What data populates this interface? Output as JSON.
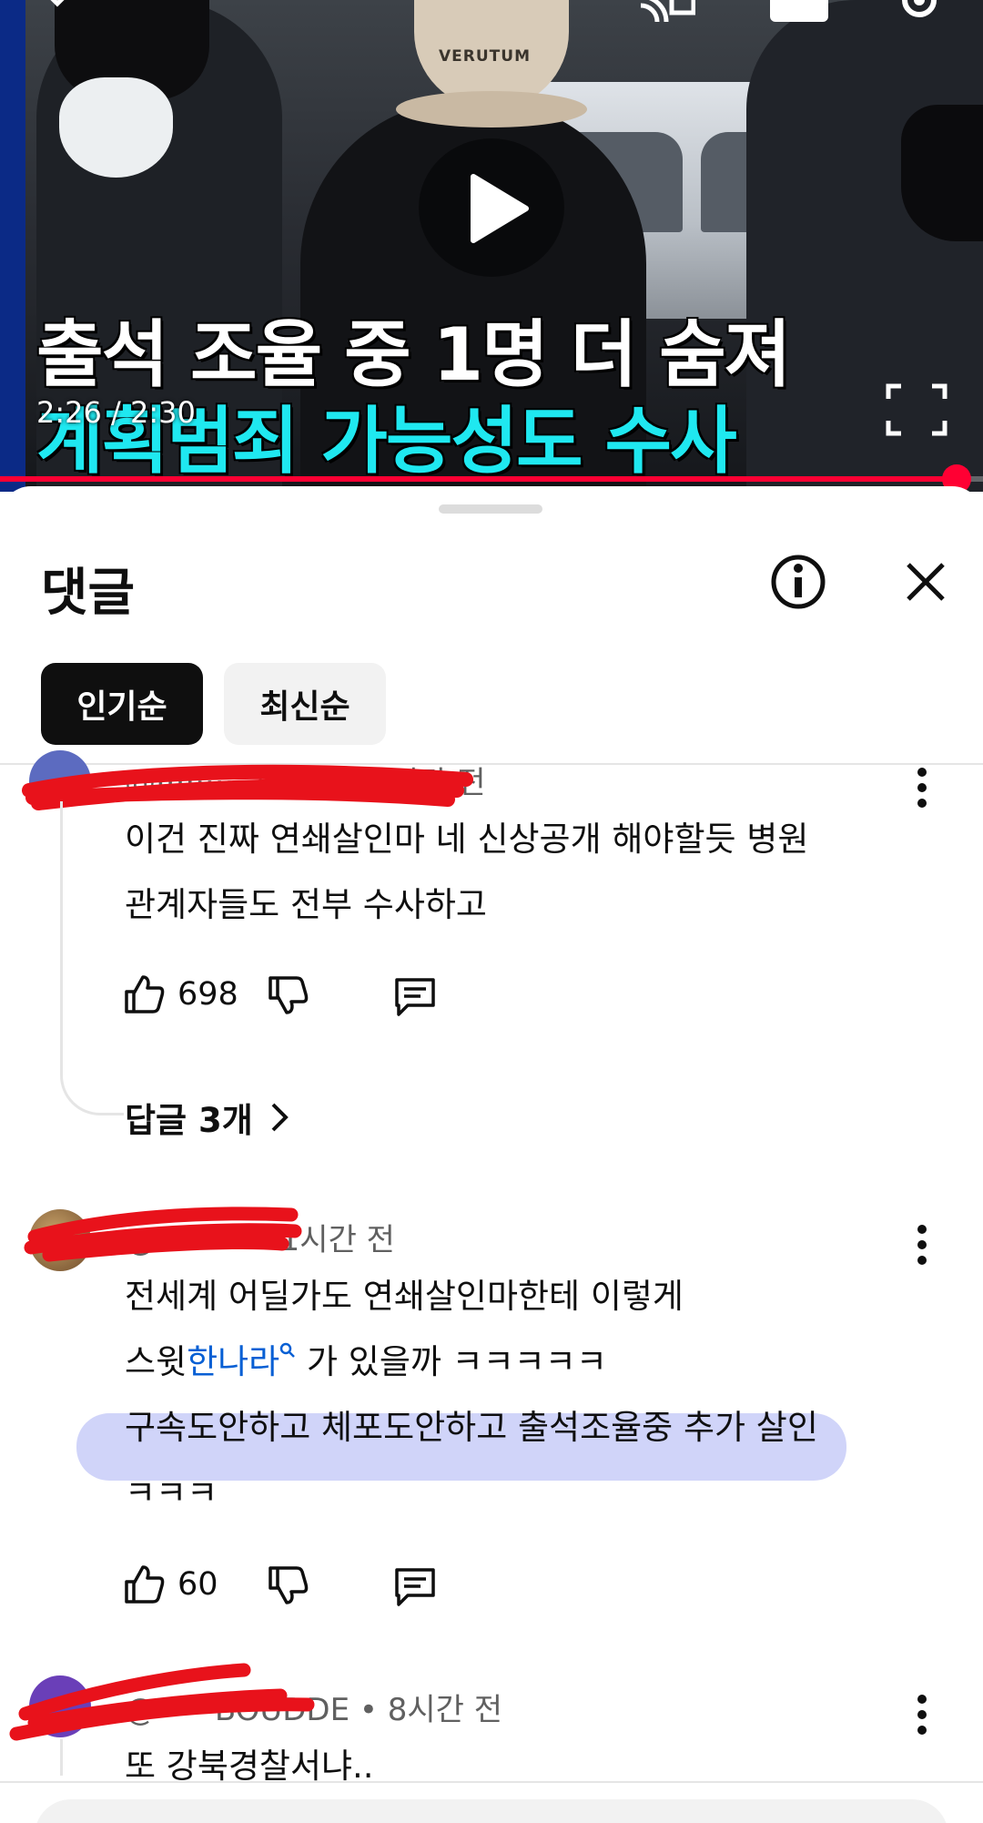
{
  "video": {
    "caption_line1": "출석 조율 중 1명 더 숨져",
    "caption_line2": "계획범죄 가능성도 수사",
    "cap_text": "VERUTUM",
    "time": "2:26 / 2:30",
    "progress_fraction": 0.973,
    "colors": {
      "progress": "#ff0033",
      "caption_accent": "#1fe8f0"
    }
  },
  "comments_panel": {
    "title": "댓글",
    "sort_tabs": [
      {
        "label": "인기순",
        "active": true
      },
      {
        "label": "최신순",
        "active": false
      }
    ]
  },
  "comments": [
    {
      "meta": "@··········4164 • 9시간 전",
      "lines": [
        "이건 진짜 연쇄살인마 네  신상공개 해야할듯  병원",
        "관계자들도 전부 수사하고"
      ],
      "likes": "698",
      "replies_label": "답글 3개"
    },
    {
      "meta": "@···그드 • 1시간 전",
      "line1": "전세계 어딜가도 연쇄살인마한테 이렇게",
      "line2_prefix": "스윗",
      "line2_link": "한나라",
      "line2_suffix": " 가 있을까 ㅋㅋㅋㅋㅋ",
      "line3": "구속도안하고 체포도안하고 출석조율중 추가 살인",
      "line4": "ㅋㅋㅋ",
      "likes": "60"
    },
    {
      "meta": "@······BOUDDE • 8시간 전",
      "lines": [
        "또 강북경찰서냐.."
      ]
    }
  ],
  "icons": {
    "play": "play-icon",
    "fullscreen": "fullscreen-icon",
    "info": "info-icon",
    "close": "close-icon",
    "like": "thumbs-up-icon",
    "dislike": "thumbs-down-icon",
    "reply": "reply-icon",
    "more": "more-vert-icon",
    "chevron": "chevron-right-icon",
    "search": "search-icon"
  }
}
